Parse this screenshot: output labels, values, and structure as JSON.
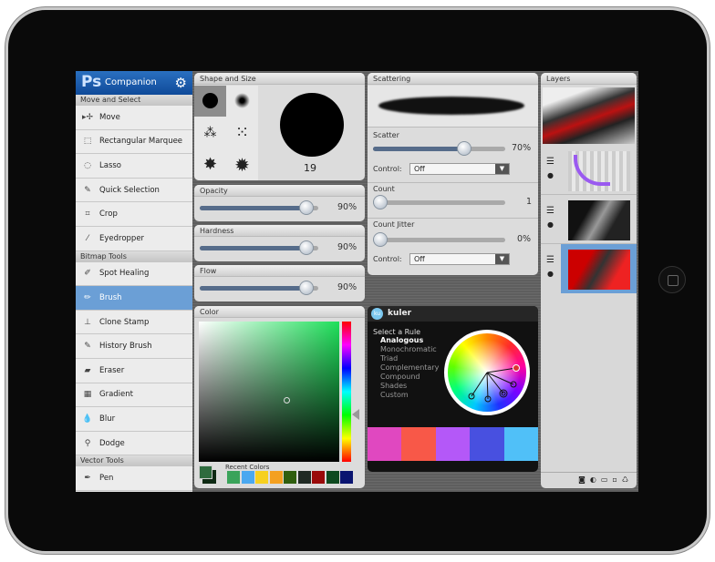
{
  "app": {
    "logo": "Ps",
    "title": "Companion",
    "settings_icon": "gear-icon"
  },
  "tools": {
    "sections": [
      {
        "label": "Move and Select",
        "items": [
          {
            "label": "Move",
            "icon": "move-icon"
          },
          {
            "label": "Rectangular Marquee",
            "icon": "marquee-icon"
          },
          {
            "label": "Lasso",
            "icon": "lasso-icon"
          },
          {
            "label": "Quick Selection",
            "icon": "quick-selection-icon"
          },
          {
            "label": "Crop",
            "icon": "crop-icon"
          },
          {
            "label": "Eyedropper",
            "icon": "eyedropper-icon"
          }
        ]
      },
      {
        "label": "Bitmap Tools",
        "items": [
          {
            "label": "Spot Healing",
            "icon": "spot-healing-icon"
          },
          {
            "label": "Brush",
            "icon": "brush-icon",
            "selected": true
          },
          {
            "label": "Clone Stamp",
            "icon": "clone-stamp-icon"
          },
          {
            "label": "History Brush",
            "icon": "history-brush-icon"
          },
          {
            "label": "Eraser",
            "icon": "eraser-icon"
          },
          {
            "label": "Gradient",
            "icon": "gradient-icon"
          },
          {
            "label": "Blur",
            "icon": "blur-icon"
          },
          {
            "label": "Dodge",
            "icon": "dodge-icon"
          }
        ]
      },
      {
        "label": "Vector Tools",
        "items": [
          {
            "label": "Pen",
            "icon": "pen-icon"
          }
        ]
      }
    ]
  },
  "shape": {
    "title": "Shape and Size",
    "size": "19"
  },
  "opacity": {
    "title": "Opacity",
    "value": "90%",
    "fraction": 0.9
  },
  "hardness": {
    "title": "Hardness",
    "value": "90%",
    "fraction": 0.9
  },
  "flow": {
    "title": "Flow",
    "value": "90%",
    "fraction": 0.9
  },
  "color": {
    "title": "Color",
    "recent_label": "Recent Colors",
    "foreground": "#2e6b3e",
    "background": "#0e2a14",
    "recent": [
      "#3aa35a",
      "#4aa8f0",
      "#f6d020",
      "#f4a020",
      "#2f5e0e",
      "#202a24",
      "#9a0a0a",
      "#0e4a20",
      "#0a1470"
    ]
  },
  "scattering": {
    "title": "Scattering",
    "scatter_label": "Scatter",
    "scatter_value": "70%",
    "scatter_fraction": 0.7,
    "control_label": "Control:",
    "control_value": "Off",
    "count_label": "Count",
    "count_value": "1",
    "count_fraction": 0,
    "jitter_label": "Count Jitter",
    "jitter_value": "0%",
    "jitter_fraction": 0,
    "control2_label": "Control:",
    "control2_value": "Off"
  },
  "kuler": {
    "title": "kuler",
    "rule_heading": "Select a Rule",
    "rules": [
      "Analogous",
      "Monochromatic",
      "Triad",
      "Complementary",
      "Compound",
      "Shades",
      "Custom"
    ],
    "selected_rule": "Analogous",
    "swatches": [
      "#e048c0",
      "#f85848",
      "#b458f8",
      "#4850e0",
      "#50c0f8"
    ]
  },
  "layers": {
    "title": "Layers",
    "footer_icons": [
      "mask-icon",
      "adjustment-icon",
      "folder-icon",
      "new-layer-icon",
      "trash-icon"
    ]
  }
}
